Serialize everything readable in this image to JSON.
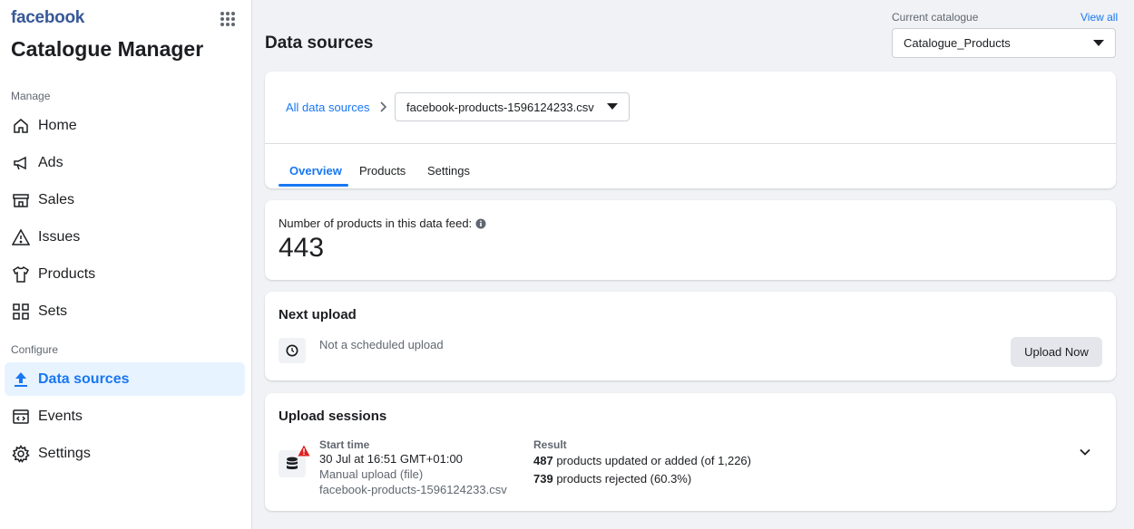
{
  "sidebar": {
    "brand": "facebook",
    "app_title": "Catalogue Manager",
    "manage_label": "Manage",
    "configure_label": "Configure",
    "items": [
      {
        "label": "Home",
        "icon": "home-icon"
      },
      {
        "label": "Ads",
        "icon": "megaphone-icon"
      },
      {
        "label": "Sales",
        "icon": "shop-icon"
      },
      {
        "label": "Issues",
        "icon": "warning-icon"
      },
      {
        "label": "Products",
        "icon": "shirt-icon"
      },
      {
        "label": "Sets",
        "icon": "grid-icon"
      },
      {
        "label": "Data sources",
        "icon": "upload-icon",
        "active": true
      },
      {
        "label": "Events",
        "icon": "code-window-icon"
      },
      {
        "label": "Settings",
        "icon": "gear-icon"
      }
    ]
  },
  "header": {
    "page_title": "Data sources",
    "current_catalogue_label": "Current catalogue",
    "view_all": "View all",
    "catalogue_value": "Catalogue_Products"
  },
  "breadcrumb": {
    "root": "All data sources",
    "file": "facebook-products-1596124233.csv"
  },
  "tabs": [
    {
      "label": "Overview",
      "active": true
    },
    {
      "label": "Products"
    },
    {
      "label": "Settings"
    }
  ],
  "feed": {
    "count_label": "Number of products in this data feed:",
    "count_value": "443"
  },
  "next_upload": {
    "title": "Next upload",
    "text": "Not a scheduled upload",
    "button": "Upload Now"
  },
  "sessions": {
    "title": "Upload sessions",
    "start_time_label": "Start time",
    "start_time": "30 Jul at 16:51 GMT+01:00",
    "method": "Manual upload (file)",
    "file": "facebook-products-1596124233.csv",
    "result_label": "Result",
    "updated_count": "487",
    "updated_text": "products updated or added (of 1,226)",
    "rejected_count": "739",
    "rejected_text": "products rejected (60.3%)"
  },
  "colors": {
    "accent": "#1877f2",
    "brand": "#385898",
    "warning": "#e02020"
  }
}
